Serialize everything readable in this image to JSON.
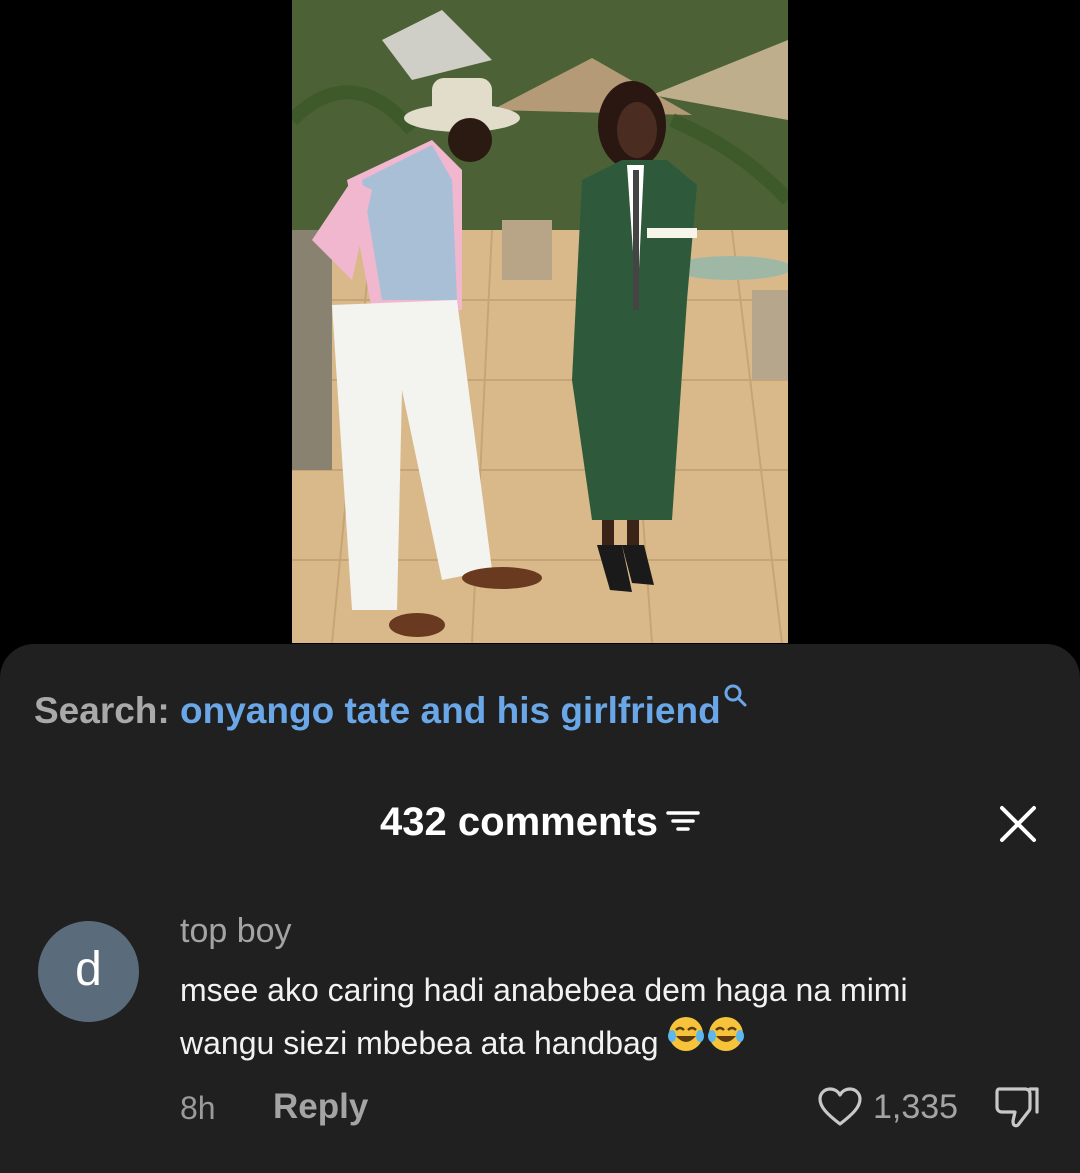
{
  "video": {
    "thumbnail_icon": "video-still-photo"
  },
  "search": {
    "prefix": "Search:",
    "query": "onyango tate and his girlfriend",
    "icon": "search-icon"
  },
  "comments": {
    "header": "432 comments",
    "filter_icon": "filter-icon",
    "close_icon": "close-icon"
  },
  "comment_item": {
    "avatar_letter": "d",
    "avatar_color": "#5a6c7c",
    "username": "top boy",
    "text_line1": "msee ako caring hadi anabebea dem haga na mimi",
    "text_line2": "wangu siezi mbebea ata handbag",
    "emoji": "😂😂",
    "time": "8h",
    "reply_label": "Reply",
    "like_count": "1,335",
    "like_icon": "heart-outline-icon",
    "dislike_icon": "thumbs-down-icon"
  },
  "colors": {
    "sheet_bg": "#202020",
    "search_link": "#6aa7e8",
    "secondary_text": "#a4a4a4",
    "primary_text": "#ffffff"
  }
}
